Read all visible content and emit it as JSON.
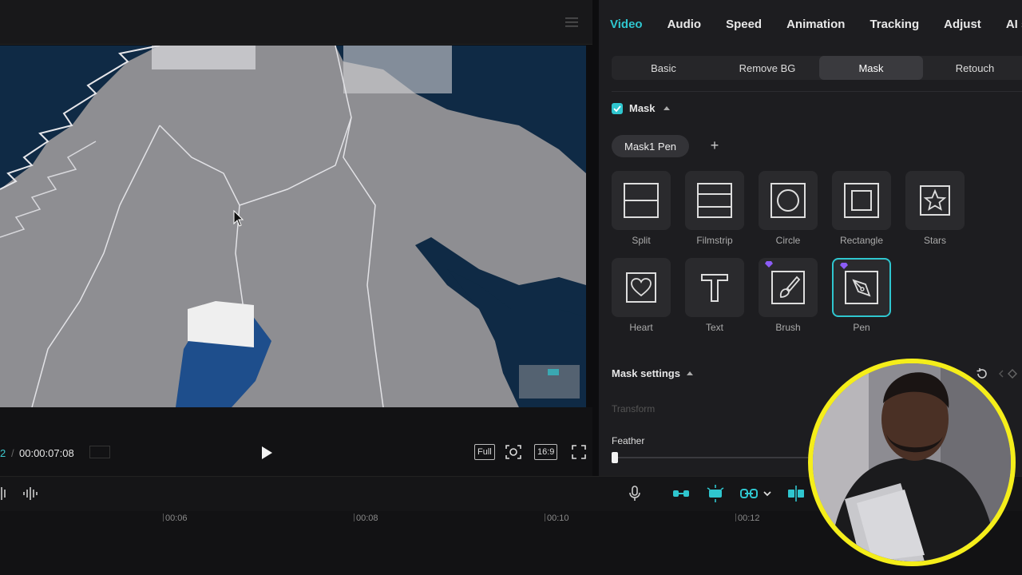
{
  "preview": {
    "timecode_current": "2",
    "timecode_separator": "/",
    "timecode_total": "00:00:07:08",
    "buttons": {
      "full": "Full",
      "ratio": "16:9"
    }
  },
  "panel": {
    "tabs": [
      {
        "label": "Video",
        "active": true
      },
      {
        "label": "Audio"
      },
      {
        "label": "Speed"
      },
      {
        "label": "Animation"
      },
      {
        "label": "Tracking"
      },
      {
        "label": "Adjust"
      },
      {
        "label": "AI sty"
      }
    ],
    "subtabs": [
      {
        "label": "Basic"
      },
      {
        "label": "Remove BG"
      },
      {
        "label": "Mask",
        "active": true
      },
      {
        "label": "Retouch"
      }
    ],
    "mask_toggle_label": "Mask",
    "mask_chip": "Mask1 Pen",
    "masks": [
      {
        "label": "Split",
        "icon": "split-icon"
      },
      {
        "label": "Filmstrip",
        "icon": "filmstrip-icon"
      },
      {
        "label": "Circle",
        "icon": "circle-icon"
      },
      {
        "label": "Rectangle",
        "icon": "rectangle-icon"
      },
      {
        "label": "Stars",
        "icon": "star-icon"
      },
      {
        "label": "Heart",
        "icon": "heart-icon"
      },
      {
        "label": "Text",
        "icon": "text-icon"
      },
      {
        "label": "Brush",
        "icon": "brush-icon",
        "premium": true
      },
      {
        "label": "Pen",
        "icon": "pen-icon",
        "premium": true,
        "selected": true
      }
    ],
    "mask_settings_label": "Mask settings",
    "transform_label": "Transform",
    "feather_label": "Feather"
  },
  "timeline": {
    "ticks": [
      "00:06",
      "00:08",
      "00:10",
      "00:12"
    ]
  },
  "colors": {
    "accent": "#2fc6cf",
    "webcam_ring": "#f5ee1a",
    "premium": "#8b5cf6"
  }
}
